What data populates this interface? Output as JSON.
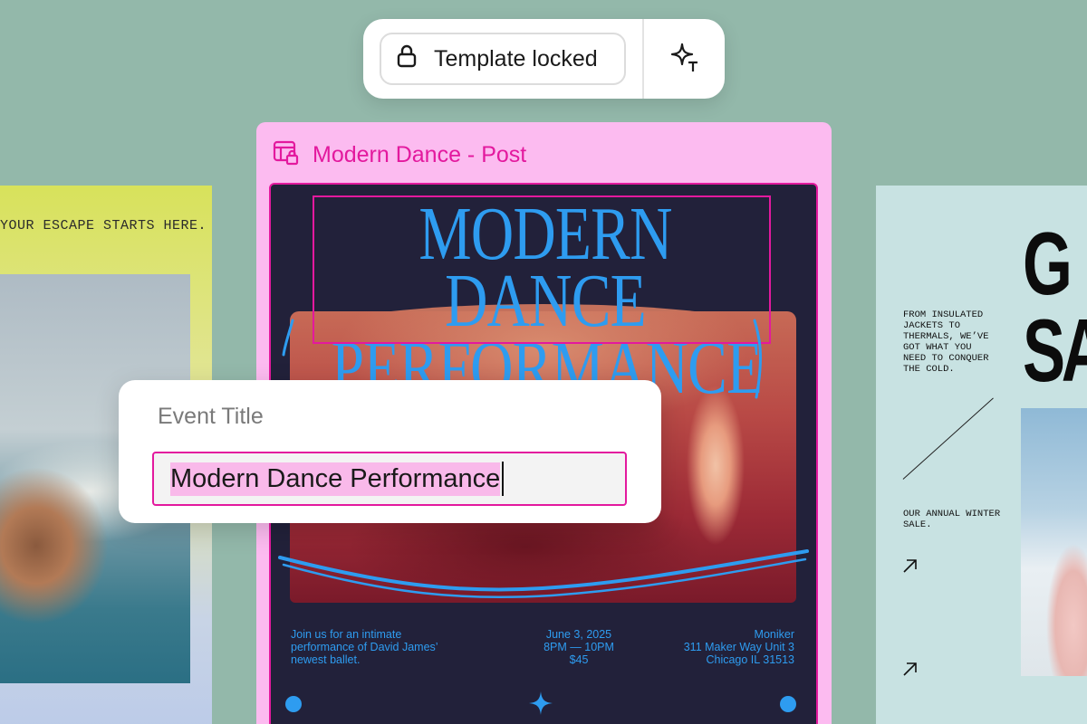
{
  "toolbar": {
    "lock_label": "Template locked",
    "lock_icon": "lock-icon",
    "ai_icon": "sparkle-text-icon"
  },
  "left_card": {
    "tagline": "YOUR ESCAPE STARTS HERE."
  },
  "frame": {
    "title": "Modern Dance - Post",
    "icon": "template-lock-icon",
    "accent_color": "#e3199e",
    "background_color": "#fcbbf0"
  },
  "poster": {
    "headline_line1": "MODERN DANCE",
    "headline_line2": "PERFORMANCE",
    "text_color": "#2e9cf0",
    "background_color": "#22213a",
    "description": [
      "Join us for an intimate",
      "performance of David James’",
      "newest ballet."
    ],
    "event_date": [
      "June 3, 2025",
      "8PM — 10PM",
      "$45"
    ],
    "venue": [
      "Moniker",
      "311 Maker Way Unit 3",
      "Chicago IL 31513"
    ]
  },
  "popover": {
    "label": "Event Title",
    "value": "Modern Dance Performance"
  },
  "right_card": {
    "big_text_line1": "G",
    "big_text_line2": "SA",
    "blurb": [
      "FROM INSULATED",
      "JACKETS TO",
      "THERMALS, WE’VE",
      "GOT WHAT YOU",
      "NEED TO CONQUER",
      "THE COLD."
    ],
    "sale_text": [
      "OUR ANNUAL WINTER",
      "SALE."
    ]
  }
}
